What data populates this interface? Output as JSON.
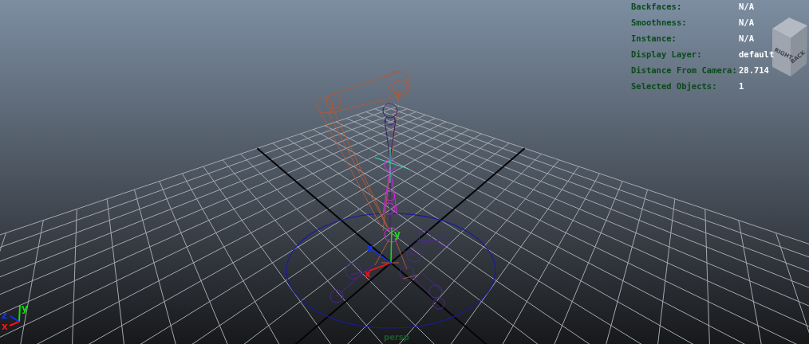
{
  "hud": [
    {
      "label": "Backfaces:",
      "value": "N/A"
    },
    {
      "label": "Smoothness:",
      "value": "N/A"
    },
    {
      "label": "Instance:",
      "value": "N/A"
    },
    {
      "label": "Display Layer:",
      "value": "default"
    },
    {
      "label": "Distance From Camera:",
      "value": "28.714"
    },
    {
      "label": "Selected Objects:",
      "value": "1"
    }
  ],
  "view_cube": {
    "faces": [
      "RIGHT",
      "BACK"
    ]
  },
  "manipulator_axes": [
    {
      "label": "x",
      "color": "#ff1010"
    },
    {
      "label": "y",
      "color": "#10e010"
    },
    {
      "label": "z",
      "color": "#1030ff"
    }
  ],
  "corner_axes": [
    {
      "label": "x",
      "color": "#ff1010"
    },
    {
      "label": "y",
      "color": "#10e010"
    },
    {
      "label": "z",
      "color": "#1030ff"
    }
  ],
  "camera_label": "persp"
}
